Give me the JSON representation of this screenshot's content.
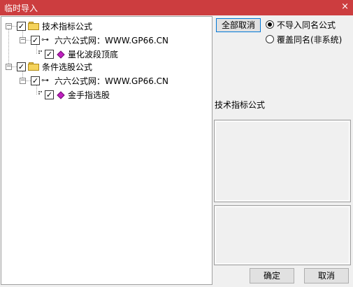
{
  "window": {
    "title": "临时导入",
    "close_glyph": "×"
  },
  "tree": {
    "groups": [
      {
        "label": "技术指标公式",
        "source": "六六公式网：WWW.GP66.CN",
        "items": [
          "量化波段顶底"
        ]
      },
      {
        "label": "条件选股公式",
        "source": "六六公式网：WWW.GP66.CN",
        "items": [
          "金手指选股"
        ]
      }
    ]
  },
  "options": {
    "cancel_all_label": "全部取消",
    "radio_no_import_label": "不导入同名公式",
    "radio_overwrite_label": "覆盖同名(非系统)",
    "selected": "no_import"
  },
  "info": {
    "category_label": "技术指标公式"
  },
  "footer": {
    "ok_label": "确定",
    "cancel_label": "取消"
  }
}
